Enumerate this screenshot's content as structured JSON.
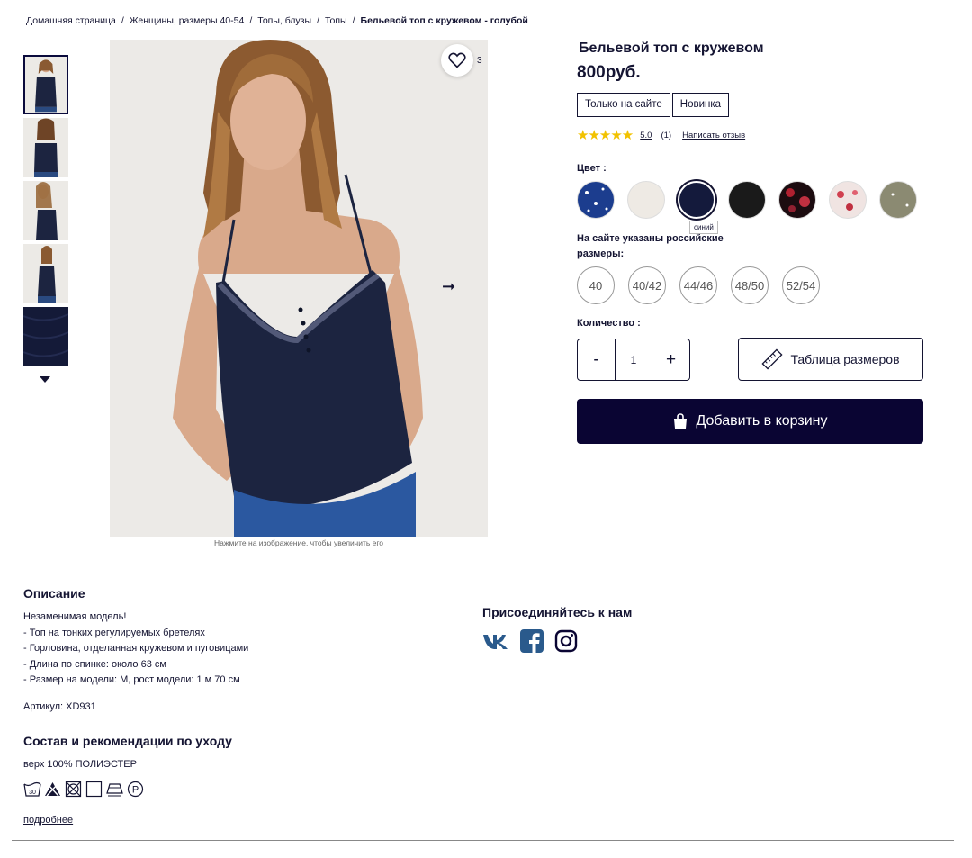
{
  "breadcrumb": {
    "items": [
      "Домашняя страница",
      "Женщины, размеры 40-54",
      "Топы, блузы",
      "Топы"
    ],
    "current": "Бельевой топ с кружевом - голубой",
    "separator": "/"
  },
  "gallery": {
    "thumbnail_icons": [
      "thumb-front",
      "thumb-back",
      "thumb-side",
      "thumb-profile",
      "thumb-fabric"
    ],
    "favorite_count": "3",
    "caption": "Нажмите на изображение, чтобы увеличить его"
  },
  "product": {
    "title": "Бельевой топ с кружевом",
    "price": "800руб.",
    "badges": [
      "Только на сайте",
      "Новинка"
    ],
    "rating_score": "5.0",
    "rating_count": "(1)",
    "write_review": "Написать отзыв",
    "rating_stars": 5
  },
  "colors": {
    "label": "Цвет :",
    "tooltip": "синий",
    "selected_index": 2,
    "swatches": [
      {
        "color": "#1c3d8e"
      },
      {
        "color": "#eeeae4"
      },
      {
        "color": "#141a3c"
      },
      {
        "color": "#1a1a1a"
      },
      {
        "color": "#3a0f18"
      },
      {
        "color": "#f0e4e2"
      },
      {
        "color": "#8b8a72"
      }
    ]
  },
  "sizes": {
    "note": "На сайте указаны российские размеры:",
    "options": [
      "40",
      "40/42",
      "44/46",
      "48/50",
      "52/54"
    ]
  },
  "quantity": {
    "label": "Количество :",
    "minus": "-",
    "value": "1",
    "plus": "+"
  },
  "size_chart": {
    "label": "Таблица размеров"
  },
  "add_to_cart": {
    "label": "Добавить в корзину"
  },
  "description": {
    "title": "Описание",
    "lines": [
      "Незаменимая модель!",
      "- Топ на тонких регулируемых бретелях",
      "- Горловина, отделанная кружевом и пуговицами",
      "- Длина по спинке: около 63 см",
      "- Размер на модели: М, рост модели: 1 м 70 см"
    ],
    "sku": "Артикул: XD931"
  },
  "care": {
    "title": "Состав и рекомендации по уходу",
    "composition": "верх 100% ПОЛИЭСТЕР",
    "wash_temp": "30",
    "icons": [
      "wash-30-icon",
      "no-bleach-icon",
      "no-tumble-dry-icon",
      "dry-flat-icon",
      "iron-low-icon",
      "dry-clean-p-icon"
    ],
    "more": "подробнее"
  },
  "social": {
    "title": "Присоединяйтесь к нам",
    "icons": [
      "vk-icon",
      "facebook-icon",
      "instagram-icon"
    ]
  },
  "colors_theme": {
    "brand": "#0a0533",
    "text": "#141432",
    "star": "#f2c200",
    "social": "#2a5a8c"
  }
}
